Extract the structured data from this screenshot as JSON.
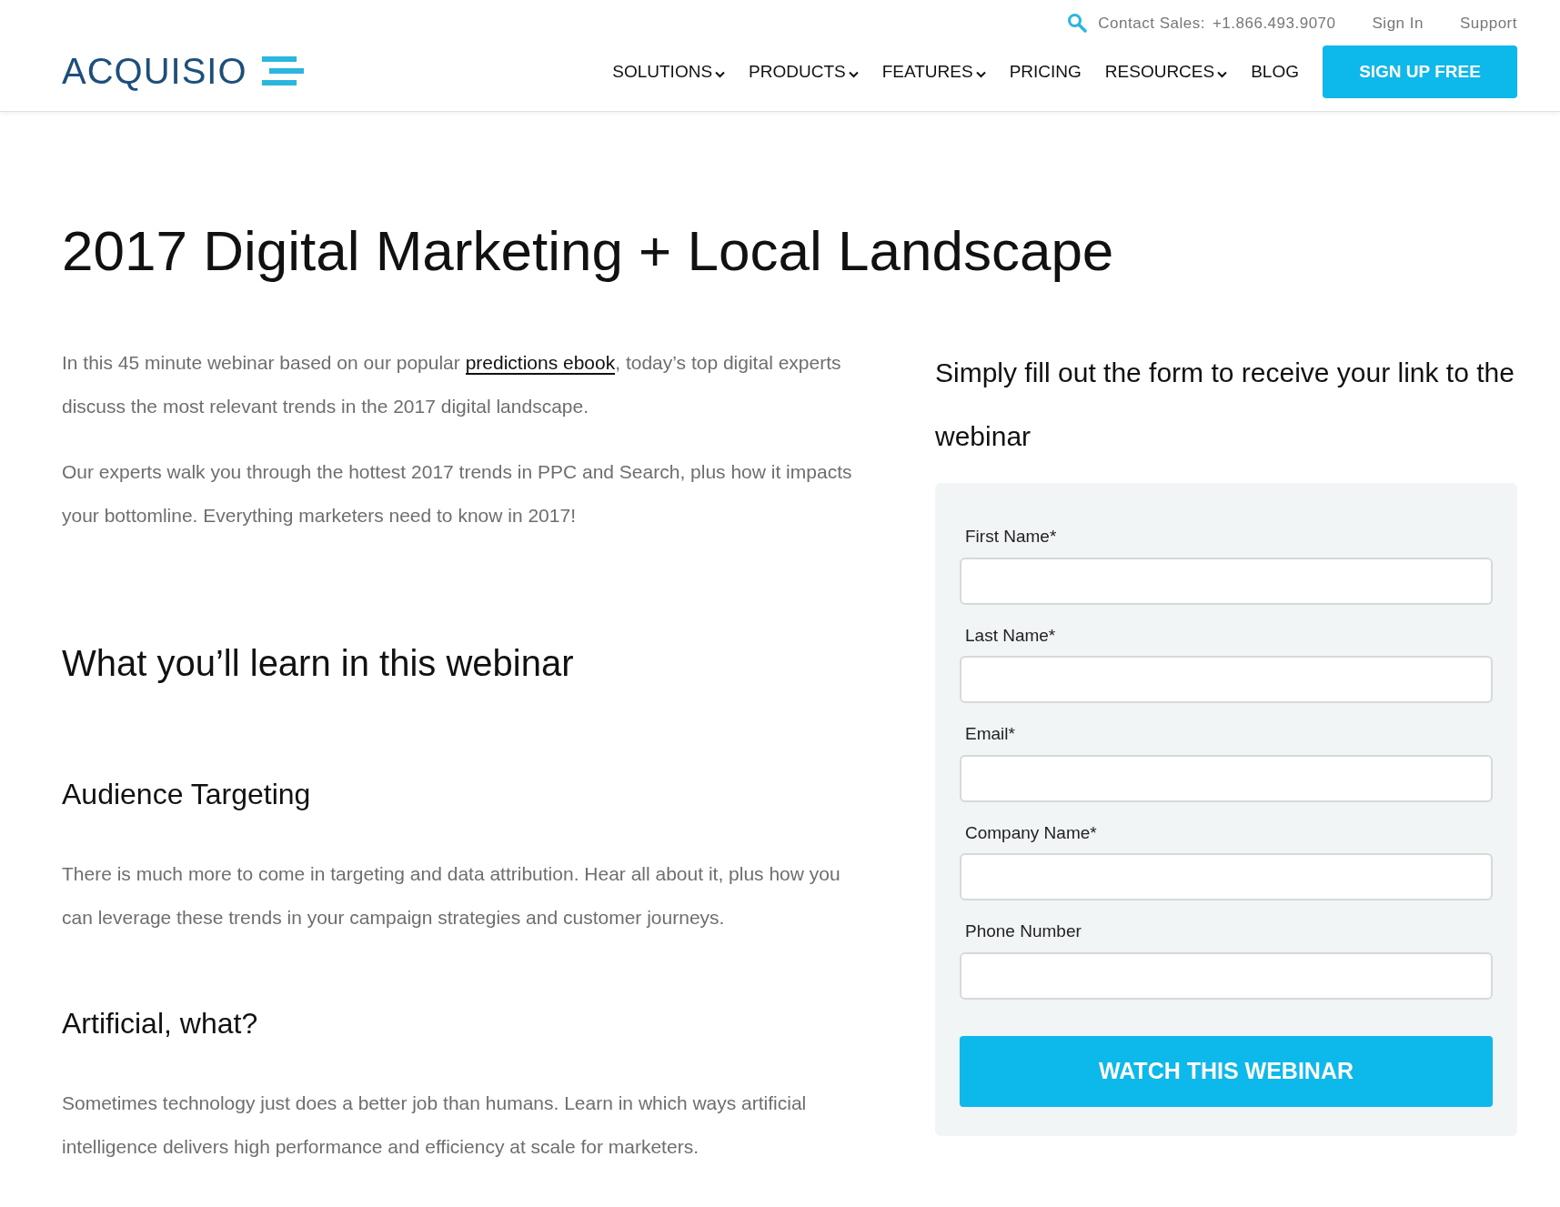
{
  "header": {
    "logo": "ACQUISIO",
    "contact": "Contact Sales:",
    "phone": "+1.866.493.9070",
    "top_links": [
      "Sign In",
      "Support"
    ],
    "nav": [
      {
        "label": "SOLUTIONS",
        "dropdown": true
      },
      {
        "label": "PRODUCTS",
        "dropdown": true
      },
      {
        "label": "FEATURES",
        "dropdown": true
      },
      {
        "label": "PRICING",
        "dropdown": false
      },
      {
        "label": "RESOURCES",
        "dropdown": true
      },
      {
        "label": "BLOG",
        "dropdown": false
      }
    ],
    "cta": "SIGN UP FREE"
  },
  "title": "2017 Digital Marketing + Local Landscape",
  "intro": [
    {
      "before": "In this 45 minute webinar based on our popular ",
      "link": "predictions ebook",
      "after": ", today’s top digital experts discuss the most relevant trends in the 2017 digital landscape."
    },
    {
      "before": "Our experts walk you through the hottest 2017 trends in PPC and Search, plus how it impacts your bottomline. Everything marketers need to know in 2017!"
    }
  ],
  "learn_heading": "What you’ll learn in this webinar",
  "sections": [
    {
      "heading": "Audience Targeting",
      "text": "There is much more to come in targeting and data attribution. Hear all about it, plus how you can leverage these trends in your campaign strategies and customer journeys."
    },
    {
      "heading": "Artificial, what?",
      "text": "Sometimes technology just does a better job than humans. Learn in which ways artificial intelligence delivers high performance and efficiency at scale for marketers."
    }
  ],
  "form": {
    "heading": "Simply fill out the form to receive your link to the webinar",
    "fields": [
      "First Name*",
      "Last Name*",
      "Email*",
      "Company Name*",
      "Phone Number"
    ],
    "submit": "WATCH THIS WEBINAR"
  }
}
